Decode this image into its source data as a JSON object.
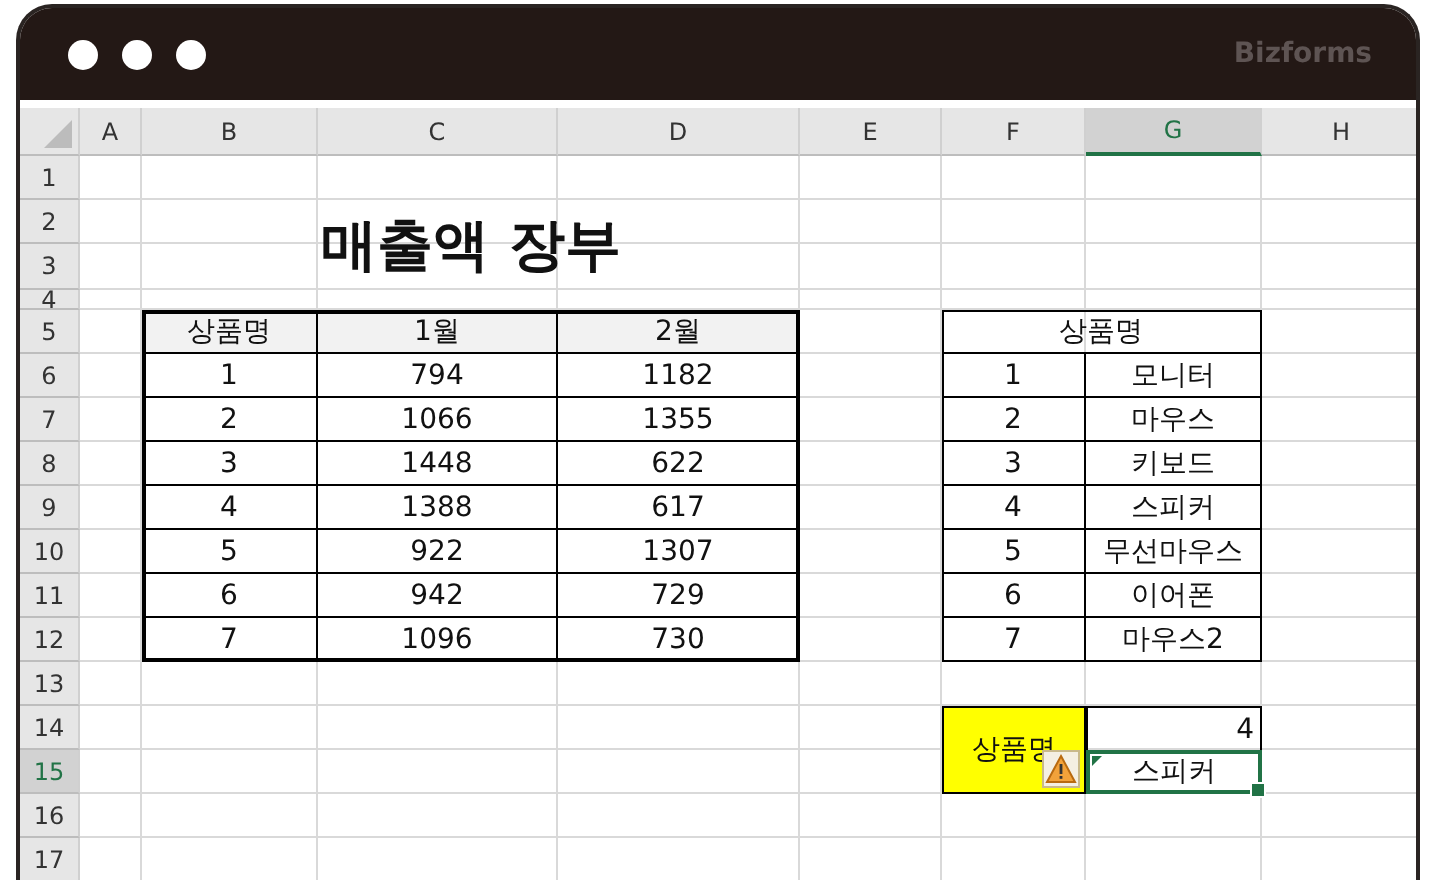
{
  "window": {
    "brand": "Bizforms"
  },
  "columns": [
    {
      "label": "A",
      "selected": false
    },
    {
      "label": "B",
      "selected": false
    },
    {
      "label": "C",
      "selected": false
    },
    {
      "label": "D",
      "selected": false
    },
    {
      "label": "E",
      "selected": false
    },
    {
      "label": "F",
      "selected": false
    },
    {
      "label": "G",
      "selected": true
    },
    {
      "label": "H",
      "selected": false
    }
  ],
  "rows": [
    {
      "label": "1",
      "selected": false
    },
    {
      "label": "2",
      "selected": false
    },
    {
      "label": "3",
      "selected": false
    },
    {
      "label": "4",
      "selected": false
    },
    {
      "label": "5",
      "selected": false
    },
    {
      "label": "6",
      "selected": false
    },
    {
      "label": "7",
      "selected": false
    },
    {
      "label": "8",
      "selected": false
    },
    {
      "label": "9",
      "selected": false
    },
    {
      "label": "10",
      "selected": false
    },
    {
      "label": "11",
      "selected": false
    },
    {
      "label": "12",
      "selected": false
    },
    {
      "label": "13",
      "selected": false
    },
    {
      "label": "14",
      "selected": false
    },
    {
      "label": "15",
      "selected": true
    },
    {
      "label": "16",
      "selected": false
    },
    {
      "label": "17",
      "selected": false
    }
  ],
  "title": "매출액 장부",
  "sales_table": {
    "columns": [
      "상품명",
      "1월",
      "2월"
    ],
    "rows": [
      [
        "1",
        "794",
        "1182"
      ],
      [
        "2",
        "1066",
        "1355"
      ],
      [
        "3",
        "1448",
        "622"
      ],
      [
        "4",
        "1388",
        "617"
      ],
      [
        "5",
        "922",
        "1307"
      ],
      [
        "6",
        "942",
        "729"
      ],
      [
        "7",
        "1096",
        "730"
      ]
    ]
  },
  "product_table": {
    "header": "상품명",
    "rows": [
      [
        "1",
        "모니터"
      ],
      [
        "2",
        "마우스"
      ],
      [
        "3",
        "키보드"
      ],
      [
        "4",
        "스피커"
      ],
      [
        "5",
        "무선마우스"
      ],
      [
        "6",
        "이어폰"
      ],
      [
        "7",
        "마우스2"
      ]
    ]
  },
  "lookup": {
    "label": "상품명",
    "number": "4",
    "result": "스피커",
    "result_selected": true,
    "warning": true
  }
}
